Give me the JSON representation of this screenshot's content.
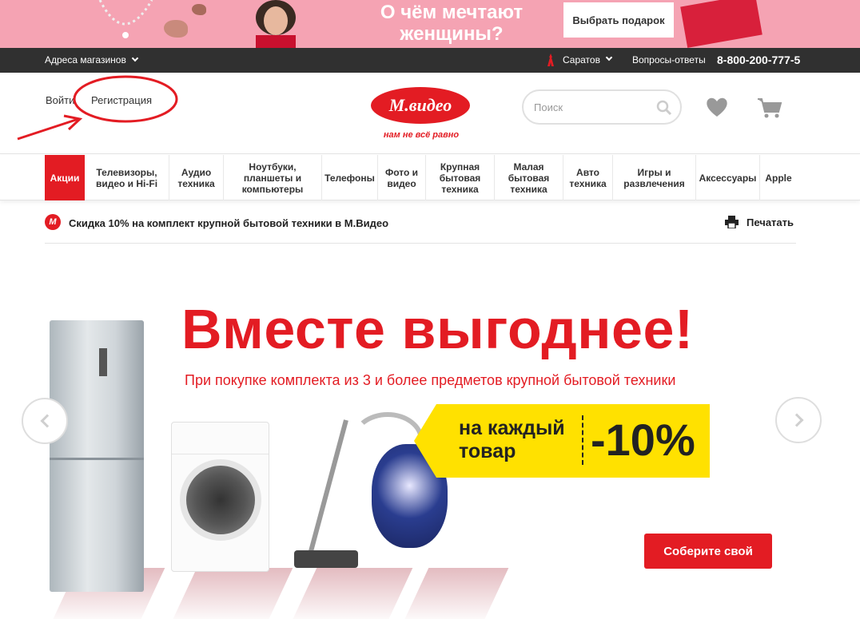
{
  "promo": {
    "title": "О чём мечтают женщины?",
    "button_label": "Выбрать подарок",
    "background_color": "#f5a3b3"
  },
  "topbar": {
    "stores_label": "Адреса магазинов",
    "city_label": "Саратов",
    "faq_label": "Вопросы-ответы",
    "phone": "8-800-200-777-5"
  },
  "header": {
    "login_label": "Войти",
    "register_label": "Регистрация",
    "logo_text": "М.видео",
    "tagline": "нам не всё равно",
    "search_placeholder": "Поиск",
    "brand_color": "#e31c23"
  },
  "nav": {
    "items": [
      "Акции",
      "Телевизоры, видео и Hi-Fi",
      "Аудио техника",
      "Ноутбуки, планшеты и компьютеры",
      "Телефоны",
      "Фото и видео",
      "Крупная бытовая техника",
      "Малая бытовая техника",
      "Авто техника",
      "Игры и развлечения",
      "Аксессуары",
      "Apple"
    ]
  },
  "info": {
    "logo_letter": "М",
    "text": "Скидка 10% на комплект крупной бытовой техники в М.Видео",
    "print_label": "Печатать"
  },
  "hero": {
    "title": "Вместе выгоднее!",
    "subtitle": "При покупке комплекта из 3 и более предметов крупной бытовой техники",
    "tag_text": "на каждый товар",
    "tag_value": "-10%",
    "cta_label": "Соберите свой",
    "tag_color": "#ffe100"
  }
}
